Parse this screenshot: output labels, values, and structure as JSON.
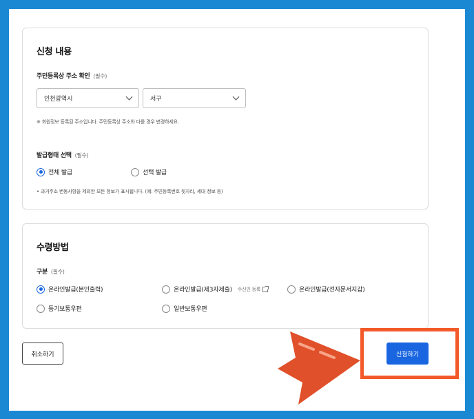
{
  "colors": {
    "frame_border": "#1b88d3",
    "primary": "#1a66e0",
    "highlight": "#f25a2a",
    "arrow": "#e0502a"
  },
  "apply_section": {
    "title": "신청 내용",
    "address_label": "주민등록상 주소 확인",
    "address_required": "(필수)",
    "city_value": "인천광역시",
    "district_value": "서구",
    "address_note": "※ 회원정보 등록된 주소입니다. 주민등록상 주소와 다를 경우 변경하세요.",
    "issue_type_label": "발급형태 선택",
    "issue_type_required": "(필수)",
    "issue_options": [
      {
        "label": "전체 발급",
        "checked": true
      },
      {
        "label": "선택 발급",
        "checked": false
      }
    ],
    "issue_note": "• 과거주소 변동사항을 제외한 모든 정보가 표시됩니다. (예: 주민등록번호 뒷자리, 세대 정보 등)"
  },
  "receive_section": {
    "title": "수령방법",
    "category_label": "구분",
    "category_required": "(필수)",
    "options": [
      {
        "label": "온라인발급(본인출력)",
        "checked": true
      },
      {
        "label": "온라인발급(제3자제출)",
        "checked": false,
        "extra": "수신인 등록"
      },
      {
        "label": "온라인발급(전자문서지갑)",
        "checked": false
      },
      {
        "label": "등기보통우편",
        "checked": false
      },
      {
        "label": "일반보통우편",
        "checked": false
      }
    ]
  },
  "buttons": {
    "cancel": "취소하기",
    "submit": "신청하기"
  },
  "icons": {
    "dropdown": "chevron-down-icon",
    "external": "external-link-icon",
    "pointer": "arrow-pointer-icon"
  }
}
